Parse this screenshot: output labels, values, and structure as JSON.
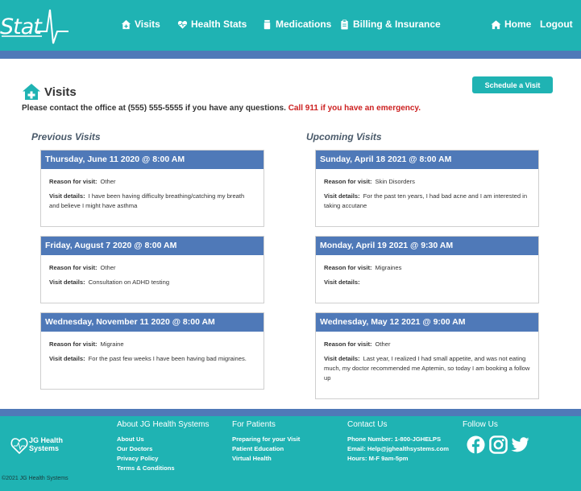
{
  "header": {
    "logo_text": "Stat",
    "nav": {
      "visits": "Visits",
      "health_stats": "Health Stats",
      "medications": "Medications",
      "billing": "Billing & Insurance",
      "home": "Home",
      "logout": "Logout"
    }
  },
  "main": {
    "title": "Visits",
    "contact_text": "Please contact the office at (555) 555-5555 if you have any questions.",
    "emergency_text": "Call 911 if you have an emergency.",
    "schedule_label": "Schedule a Visit",
    "reason_label": "Reason for visit:",
    "details_label": "Visit details:",
    "previous_title": "Previous Visits",
    "upcoming_title": "Upcoming Visits",
    "previous": [
      {
        "date": "Thursday, June 11 2020 @ 8:00 AM",
        "reason": "Other",
        "details": "I have been having difficulty breathing/catching my breath and believe I might have asthma"
      },
      {
        "date": "Friday, August 7 2020 @ 8:00 AM",
        "reason": "Other",
        "details": "Consultation on ADHD testing"
      },
      {
        "date": "Wednesday, November 11 2020 @ 8:00 AM",
        "reason": "Migraine",
        "details": "For the past few weeks I have been having bad migraines."
      }
    ],
    "upcoming": [
      {
        "date": "Sunday, April 18 2021 @ 8:00 AM",
        "reason": "Skin Disorders",
        "details": "For the past ten years, I had bad acne and I am interested in taking accutane"
      },
      {
        "date": "Monday, April 19 2021 @ 9:30 AM",
        "reason": "Migraines",
        "details": ""
      },
      {
        "date": "Wednesday, May 12 2021 @ 9:00 AM",
        "reason": "Other",
        "details": "Last year, I realized I had small appetite, and was not eating much, my doctor recommended me Aptemin, so today I am booking a follow up"
      }
    ]
  },
  "footer": {
    "logo_line1": "JG Health",
    "logo_line2": "Systems",
    "about_title": "About JG Health Systems",
    "about_links": [
      "About Us",
      "Our Doctors",
      "Privacy Policy",
      "Terms & Conditions"
    ],
    "patients_title": "For Patients",
    "patients_links": [
      "Preparing for your Visit",
      "Patient Education",
      "Virtual Health"
    ],
    "contact_title": "Contact Us",
    "contact_lines": [
      "Phone Number: 1-800-JGHELPS",
      "Email: Help@jghealthsystems.com",
      "Hours: M-F 9am-5pm"
    ],
    "follow_title": "Follow Us",
    "copyright": "©2021 JG Health Systems"
  },
  "colors": {
    "teal": "#1fb3b3",
    "blue": "#4f79b8",
    "emergency_red": "#cc1f1f"
  },
  "icons": [
    "heartbeat-logo-icon",
    "house-medical-icon",
    "heart-pulse-icon",
    "medication-icon",
    "clipboard-icon",
    "home-icon",
    "facebook-icon",
    "instagram-icon",
    "twitter-icon"
  ]
}
